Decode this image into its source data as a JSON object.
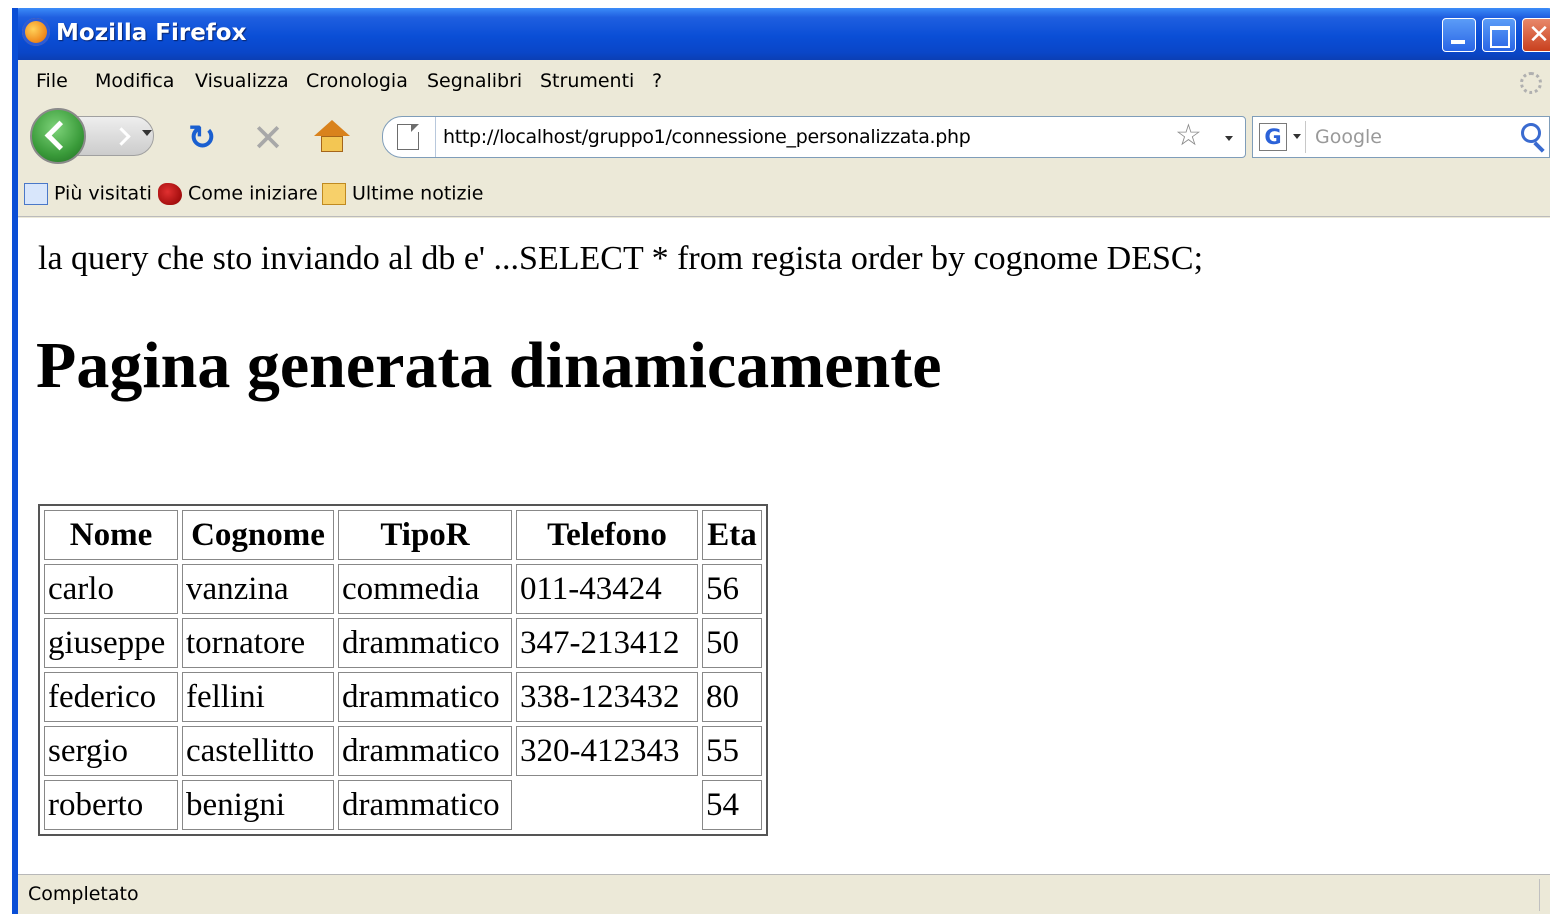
{
  "window": {
    "title": "Mozilla Firefox"
  },
  "menu": [
    "File",
    "Modifica",
    "Visualizza",
    "Cronologia",
    "Segnalibri",
    "Strumenti",
    "?"
  ],
  "nav": {
    "url": "http://localhost/gruppo1/connessione_personalizzata.php",
    "search_placeholder": "Google",
    "search_engine_icon": "G",
    "icons": [
      "back-icon",
      "forward-icon",
      "reload-icon",
      "stop-icon",
      "home-icon",
      "bookmark-star-icon",
      "search-icon"
    ]
  },
  "bookmarks": [
    {
      "label": "Più visitati",
      "icon": "most-visited-icon"
    },
    {
      "label": "Come iniziare",
      "icon": "getting-started-icon"
    },
    {
      "label": "Ultime notizie",
      "icon": "rss-feed-icon"
    }
  ],
  "page": {
    "query_text": "la query che sto inviando al db e' ...SELECT * from regista order by cognome DESC;",
    "heading": "Pagina generata dinamicamente",
    "table": {
      "headers": [
        "Nome",
        "Cognome",
        "TipoR",
        "Telefono",
        "Eta"
      ],
      "rows": [
        [
          "carlo",
          "vanzina",
          "commedia",
          "011-43424",
          "56"
        ],
        [
          "giuseppe",
          "tornatore",
          "drammatico",
          "347-213412",
          "50"
        ],
        [
          "federico",
          "fellini",
          "drammatico",
          "338-123432",
          "80"
        ],
        [
          "sergio",
          "castellitto",
          "drammatico",
          "320-412343",
          "55"
        ],
        [
          "roberto",
          "benigni",
          "drammatico",
          "",
          "54"
        ]
      ]
    }
  },
  "status": {
    "text": "Completato"
  }
}
